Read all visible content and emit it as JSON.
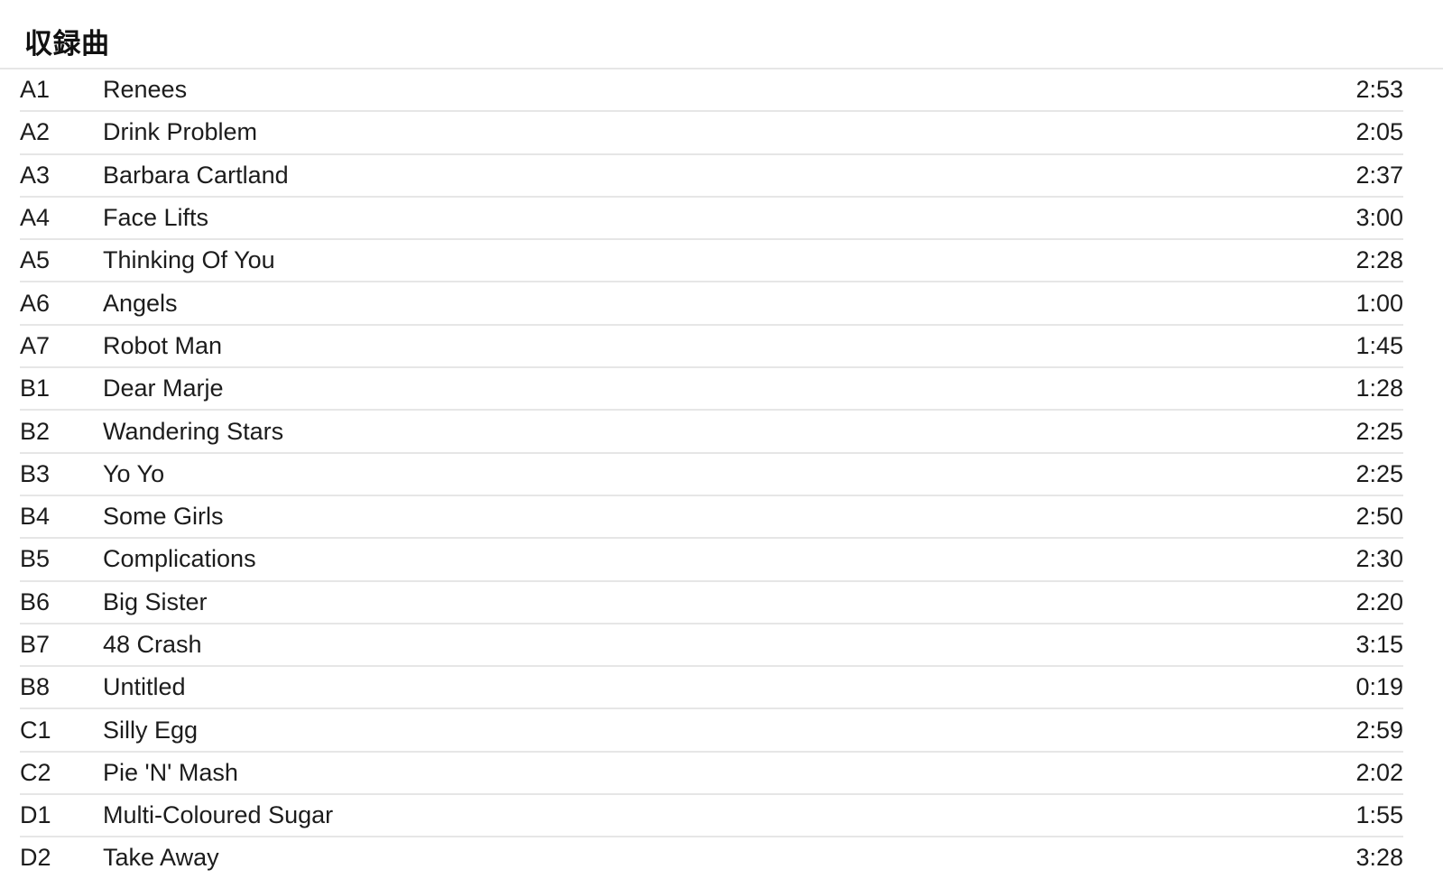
{
  "section": {
    "heading": "収録曲"
  },
  "colors": {
    "text": "#1c1c1c",
    "heading": "#111111",
    "separator": "#e6e6e6",
    "background": "#ffffff"
  },
  "tracklist": {
    "columns": [
      "position",
      "title",
      "duration"
    ],
    "rows": [
      {
        "position": "A1",
        "title": "Renees",
        "duration": "2:53"
      },
      {
        "position": "A2",
        "title": "Drink Problem",
        "duration": "2:05"
      },
      {
        "position": "A3",
        "title": "Barbara Cartland",
        "duration": "2:37"
      },
      {
        "position": "A4",
        "title": "Face Lifts",
        "duration": "3:00"
      },
      {
        "position": "A5",
        "title": "Thinking Of You",
        "duration": "2:28"
      },
      {
        "position": "A6",
        "title": "Angels",
        "duration": "1:00"
      },
      {
        "position": "A7",
        "title": "Robot Man",
        "duration": "1:45"
      },
      {
        "position": "B1",
        "title": "Dear Marje",
        "duration": "1:28"
      },
      {
        "position": "B2",
        "title": "Wandering Stars",
        "duration": "2:25"
      },
      {
        "position": "B3",
        "title": "Yo Yo",
        "duration": "2:25"
      },
      {
        "position": "B4",
        "title": "Some Girls",
        "duration": "2:50"
      },
      {
        "position": "B5",
        "title": "Complications",
        "duration": "2:30"
      },
      {
        "position": "B6",
        "title": "Big Sister",
        "duration": "2:20"
      },
      {
        "position": "B7",
        "title": "48 Crash",
        "duration": "3:15"
      },
      {
        "position": "B8",
        "title": "Untitled",
        "duration": "0:19"
      },
      {
        "position": "C1",
        "title": "Silly Egg",
        "duration": "2:59"
      },
      {
        "position": "C2",
        "title": "Pie 'N' Mash",
        "duration": "2:02"
      },
      {
        "position": "D1",
        "title": "Multi-Coloured Sugar",
        "duration": "1:55"
      },
      {
        "position": "D2",
        "title": "Take Away",
        "duration": "3:28"
      }
    ]
  }
}
